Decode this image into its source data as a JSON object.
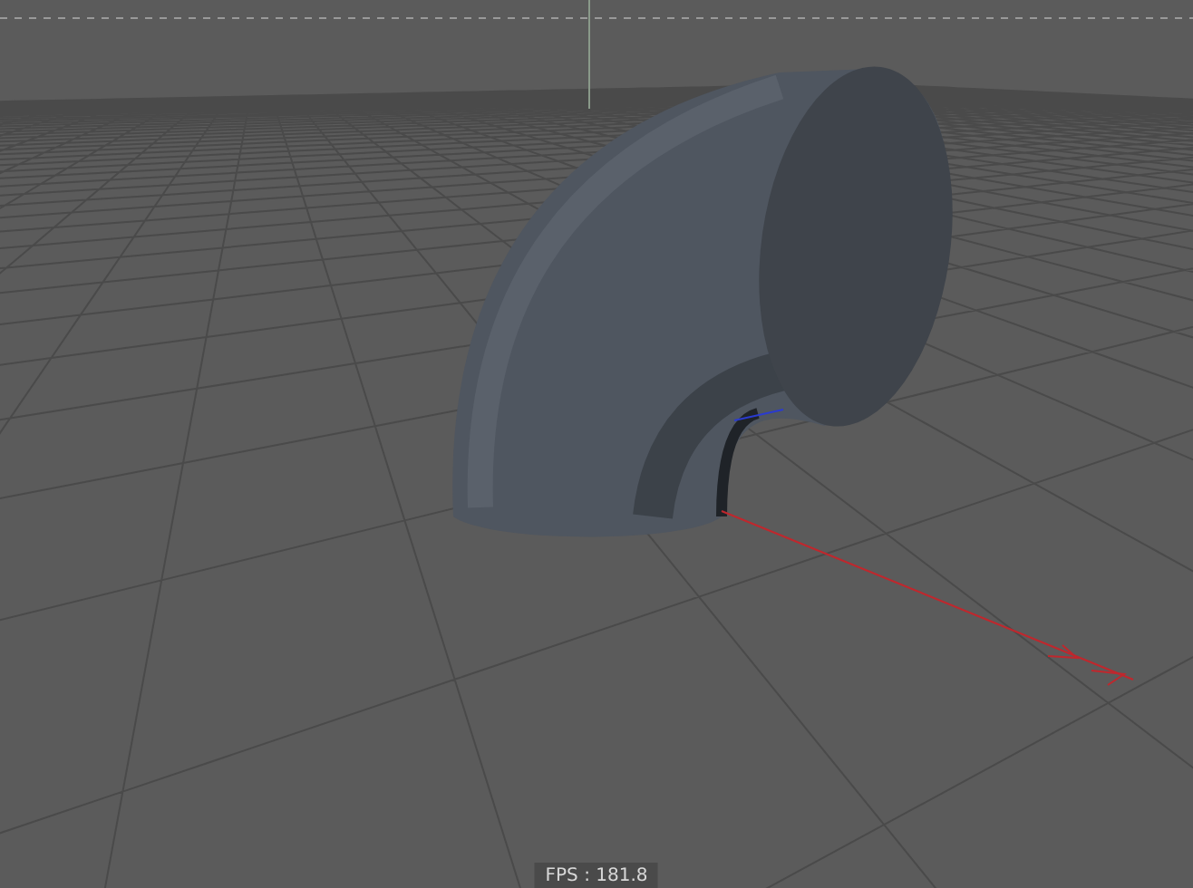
{
  "viewport": {
    "fps_label": "FPS : 181.8"
  }
}
